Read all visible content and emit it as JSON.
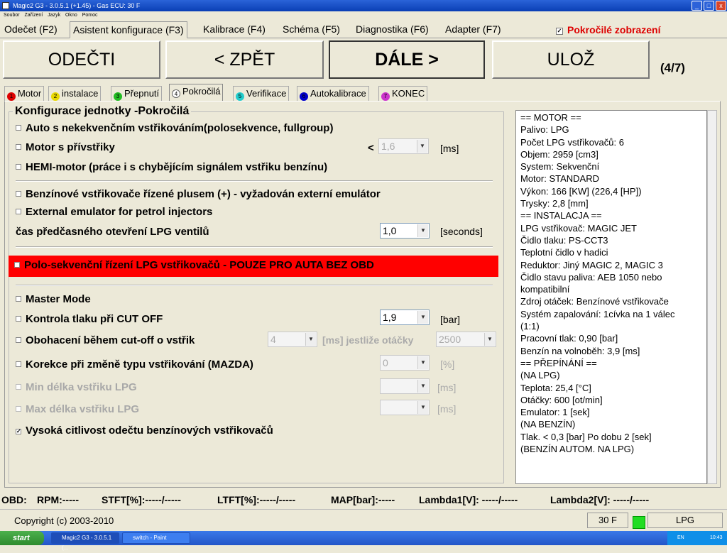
{
  "window": {
    "title": "Magic2 G3 - 3.0.5.1 (+1.45) - Gas ECU: 30 F"
  },
  "menu": [
    "Soubor",
    "Zařízení",
    "Jazyk",
    "Okno",
    "Pomoc"
  ],
  "main_tabs": [
    "Odečet (F2)",
    "Asistent konfigurace (F3)",
    "Kalibrace (F4)",
    "Schéma (F5)",
    "Diagnostika (F6)",
    "Adapter (F7)"
  ],
  "advanced_display": {
    "label": "Pokročilé zobrazení",
    "checked": true
  },
  "nav": {
    "read": "ODEČTI",
    "back": "< ZPĚT",
    "next": "DÁLE >",
    "save": "ULOŽ",
    "step": "(4/7)"
  },
  "wizard_tabs": [
    {
      "num": "1",
      "label": "Motor",
      "color": "#dd0000"
    },
    {
      "num": "2",
      "label": "instalace",
      "color": "#e8d800"
    },
    {
      "num": "3",
      "label": "Přepnutí",
      "color": "#22bb22"
    },
    {
      "num": "4",
      "label": "Pokročilá",
      "color": "#ffffff"
    },
    {
      "num": "5",
      "label": "Verifikace",
      "color": "#22cccc"
    },
    {
      "num": "6",
      "label": "Autokalibrace",
      "color": "#0000cc"
    },
    {
      "num": "7",
      "label": "KONEC",
      "color": "#cc33cc"
    }
  ],
  "group_title": "Konfigurace jednotky -Pokročilá",
  "options": {
    "nonseq": "Auto s nekekvenčním vstřikováním(polosekvence, fullgroup)",
    "extra_inj": "Motor s přívstřiky",
    "extra_inj_sign": "<",
    "extra_inj_val": "1,6",
    "extra_inj_unit": "[ms]",
    "hemi": "HEMI-motor (práce i s chybějícím signálem vstřiku benzínu)",
    "plus": "Benzínové vstřikovače řízené plusem (+)  - vyžadován externí emulátor",
    "ext_emul": "External emulator for petrol injectors",
    "preopen": "čas předčasného otevření LPG ventilů",
    "preopen_val": "1,0",
    "preopen_unit": "[seconds]",
    "semiseq": "Polo-sekvenční řízení LPG vstřikovačů - POUZE PRO AUTA BEZ OBD",
    "master": "Master Mode",
    "cutoff": "Kontrola tlaku při CUT OFF",
    "cutoff_val": "1,9",
    "cutoff_unit": "[bar]",
    "enrich": "Obohacení během cut-off o vstřik",
    "enrich_val": "4",
    "enrich_unit": "[ms] jestliže otáčky",
    "enrich_rpm": "2500",
    "mazda": "Korekce při změně typu vstřikování (MAZDA)",
    "mazda_val": "0",
    "mazda_unit": "[%]",
    "minlen": "Min délka vstřiku LPG",
    "minlen_unit": "[ms]",
    "maxlen": "Max délka vstřiku LPG",
    "maxlen_unit": "[ms]",
    "highsens": "Vysoká citlivost odečtu benzínových vstřikovačů"
  },
  "info_lines": [
    "== MOTOR ==",
    "Palivo: LPG",
    "Počet LPG vstřikovačů: 6",
    "Objem: 2959 [cm3]",
    "System: Sekvenční",
    "Motor: STANDARD",
    "Výkon: 166 [KW] (226,4 [HP])",
    "Trysky: 2,8 [mm]",
    "== INSTALACJA ==",
    "LPG vstřikovač: MAGIC JET",
    "Čidlo tlaku: PS-CCT3",
    "Teplotní čidlo v hadici",
    "Reduktor: Jiný MAGIC 2, MAGIC 3",
    "Čidlo stavu paliva: AEB 1050 nebo",
    "kompatibilní",
    "Zdroj otáček: Benzínové vstřikovače",
    "Systém zapalování: 1cívka na 1 válec",
    "(1:1)",
    "Pracovní tlak: 0,90 [bar]",
    "Benzín na volnoběh: 3,9 [ms]",
    "== PŘEPÍNÁNÍ ==",
    "(NA LPG)",
    "Teplota: 25,4 [°C]",
    "Otáčky: 600 [ot/min]",
    "Emulator: 1 [sek]",
    "(NA BENZÍN)",
    "Tlak. < 0,3 [bar] Po dobu 2 [sek]",
    "(BENZÍN AUTOM. NA LPG)"
  ],
  "status": {
    "obd": "OBD:",
    "rpm": "RPM:-----",
    "stft": "STFT[%]:-----/-----",
    "ltft": "LTFT[%]:-----/-----",
    "map": "MAP[bar]:-----",
    "lambda1": "Lambda1[V]: -----/-----",
    "lambda2": "Lambda2[V]: -----/-----"
  },
  "footer": {
    "copyright": "Copyright (c) 2003-2010",
    "ecu": "30 F",
    "fuel": "LPG"
  },
  "taskbar": {
    "start": "start",
    "task1": "Magic2 G3 - 3.0.5.1 (...",
    "task2": "switch - Paint",
    "lang": "EN",
    "time": "10:43"
  }
}
